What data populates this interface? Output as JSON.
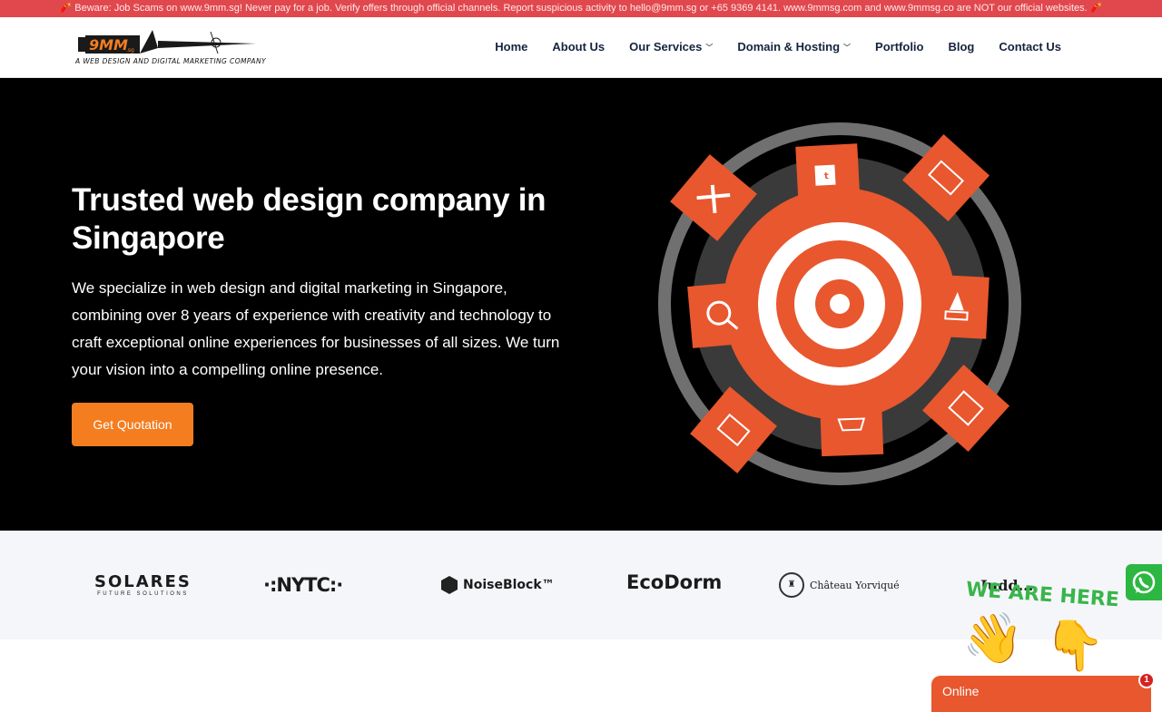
{
  "announcement": "🧨 Beware: Job Scams on www.9mm.sg! Never pay for a job. Verify offers through official channels. Report suspicious activity to hello@9mm.sg or +65 9369 4141. www.9mmsg.com and www.9mmsg.co are NOT our official websites. 🧨",
  "logo": {
    "mark": "9MM",
    "tld": ".sg",
    "tagline": "A WEB DESIGN AND DIGITAL MARKETING COMPANY"
  },
  "nav": [
    {
      "label": "Home",
      "dropdown": false
    },
    {
      "label": "About Us",
      "dropdown": false
    },
    {
      "label": "Our Services",
      "dropdown": true
    },
    {
      "label": "Domain & Hosting",
      "dropdown": true
    },
    {
      "label": "Portfolio",
      "dropdown": false
    },
    {
      "label": "Blog",
      "dropdown": false
    },
    {
      "label": "Contact Us",
      "dropdown": false
    }
  ],
  "hero": {
    "title": "Trusted web design company in Singapore",
    "body": "We specialize in web design and digital marketing in Singapore, combining over 8 years of experience with creativity and technology to craft exceptional online experiences for businesses of all sizes. We turn your vision into a compelling online presence.",
    "cta": "Get Quotation",
    "graphic_icons": [
      "design-tools-icon",
      "social-media-icon",
      "design-monitor-icon",
      "seo-icon",
      "rocket-launch-icon",
      "web-design-icon",
      "ecommerce-cart-icon",
      "layout-icon"
    ]
  },
  "clients": {
    "solares": "SOLARES",
    "solares_sub": "FUTURE SOLUTIONS",
    "nytc": "·:NYTC:·",
    "noiseblock": "NoiseBlock™",
    "ecodorm": "EcoDorm",
    "chateau": "Château Yorviqué",
    "last": "Judd..."
  },
  "widgets": {
    "we_are_here": "WE ARE HERE!",
    "chat_status": "Online",
    "chat_badge": "1"
  },
  "colors": {
    "accent": "#f47d20",
    "graphic_orange": "#e8572e",
    "announcement_bg": "#e0484e",
    "nav_text": "#16233f"
  }
}
